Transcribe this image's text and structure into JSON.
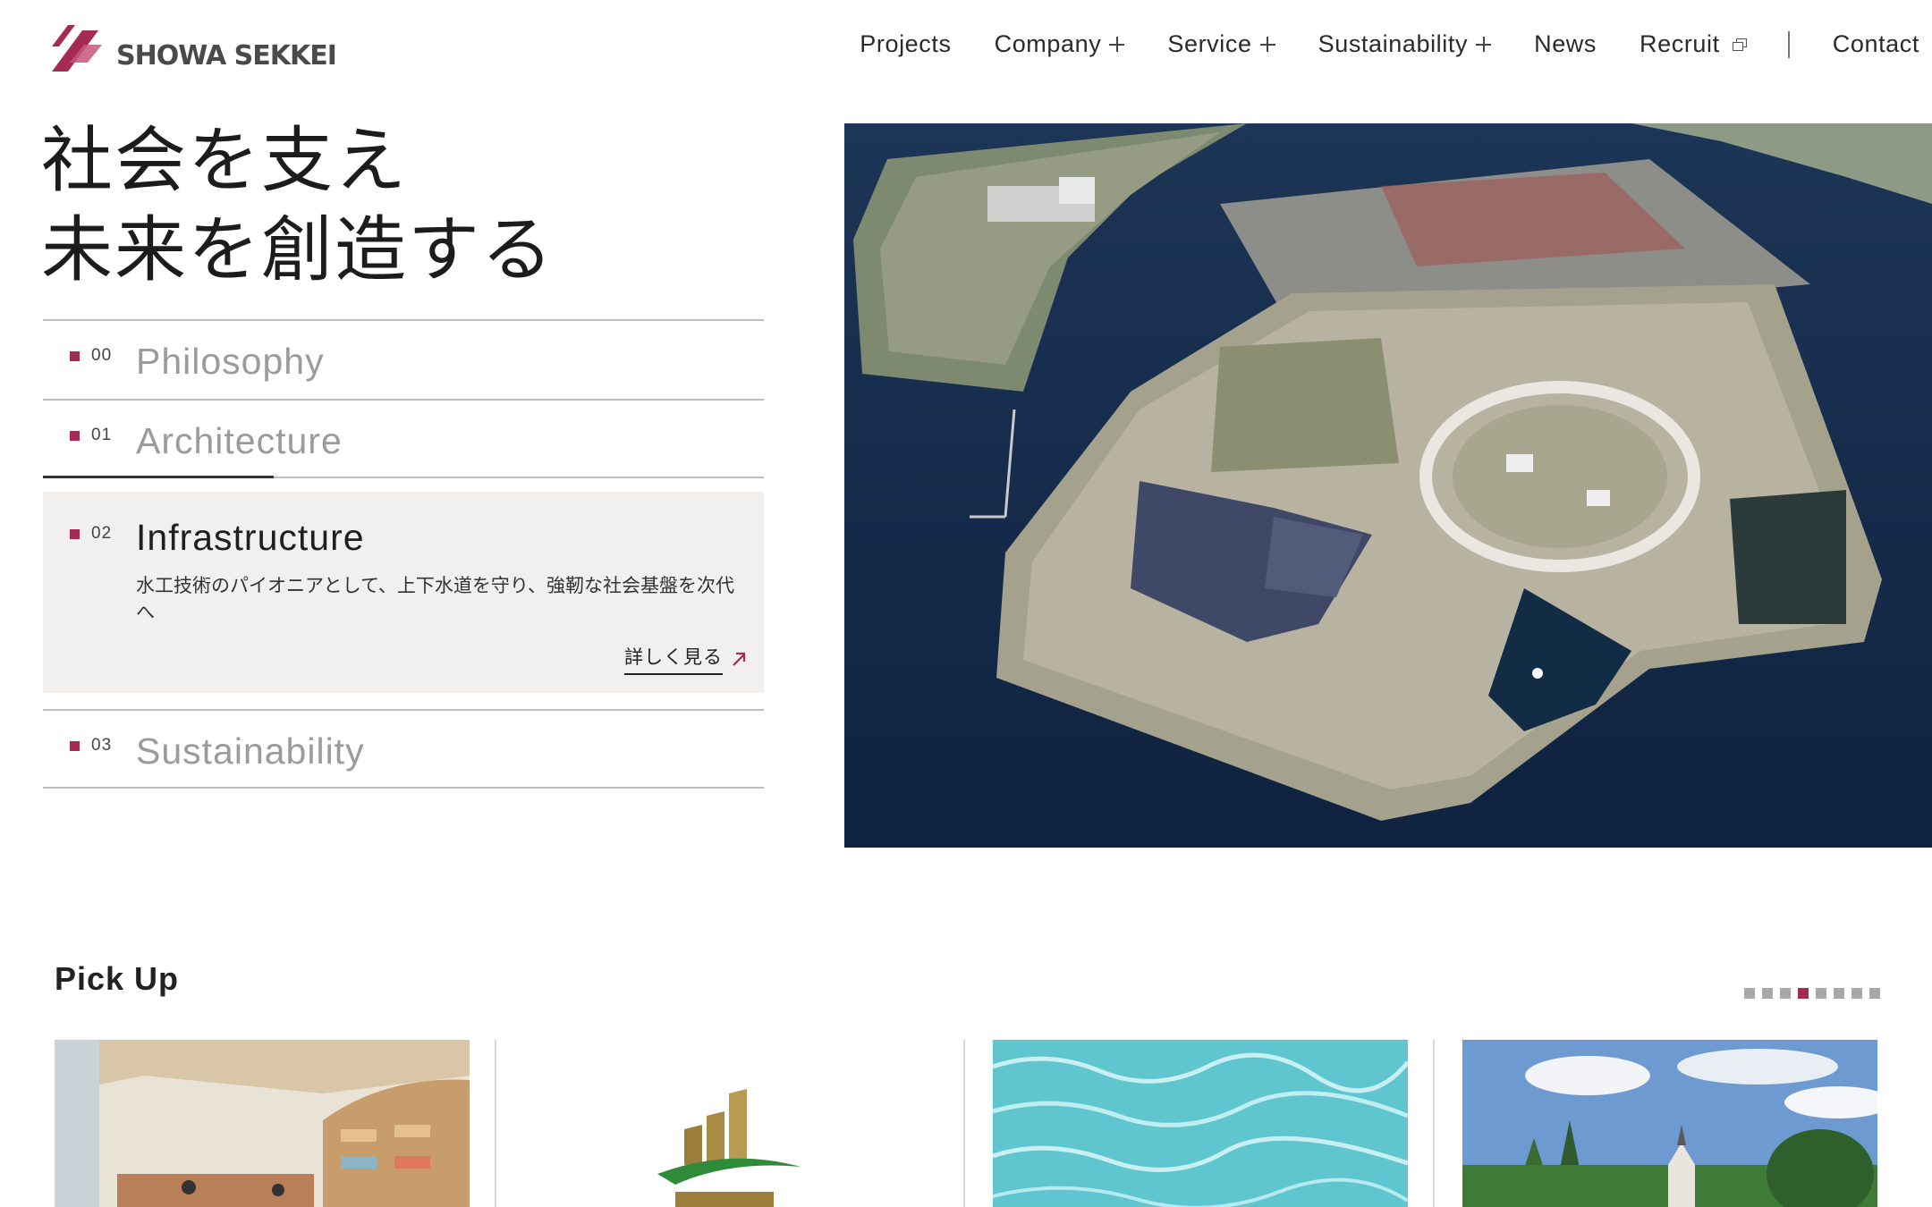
{
  "brand": {
    "name": "SHOWA SEKKEI",
    "accent": "#a52b55"
  },
  "nav": {
    "items": [
      {
        "label": "Projects"
      },
      {
        "label": "Company"
      },
      {
        "label": "Service"
      },
      {
        "label": "Sustainability"
      },
      {
        "label": "News"
      },
      {
        "label": "Recruit"
      },
      {
        "label": "Contact"
      }
    ]
  },
  "hero": {
    "title_line1": "社会を支え",
    "title_line2": "未来を創造する",
    "menu": [
      {
        "num": "00",
        "label": "Philosophy"
      },
      {
        "num": "01",
        "label": "Architecture"
      },
      {
        "num": "02",
        "label": "Infrastructure",
        "description": "水工技術のパイオニアとして、上下水道を守り、強靭な社会基盤を次代へ",
        "link": "詳しく見る"
      },
      {
        "num": "03",
        "label": "Sustainability"
      }
    ],
    "progress": 0.32
  },
  "pickup": {
    "title": "Pick Up",
    "pages": 8,
    "active_page": 4
  },
  "icons": {
    "logo": "slash-logo-icon",
    "plus": "plus-icon",
    "external": "external-window-icon",
    "arrow": "arrow-up-right-icon"
  }
}
